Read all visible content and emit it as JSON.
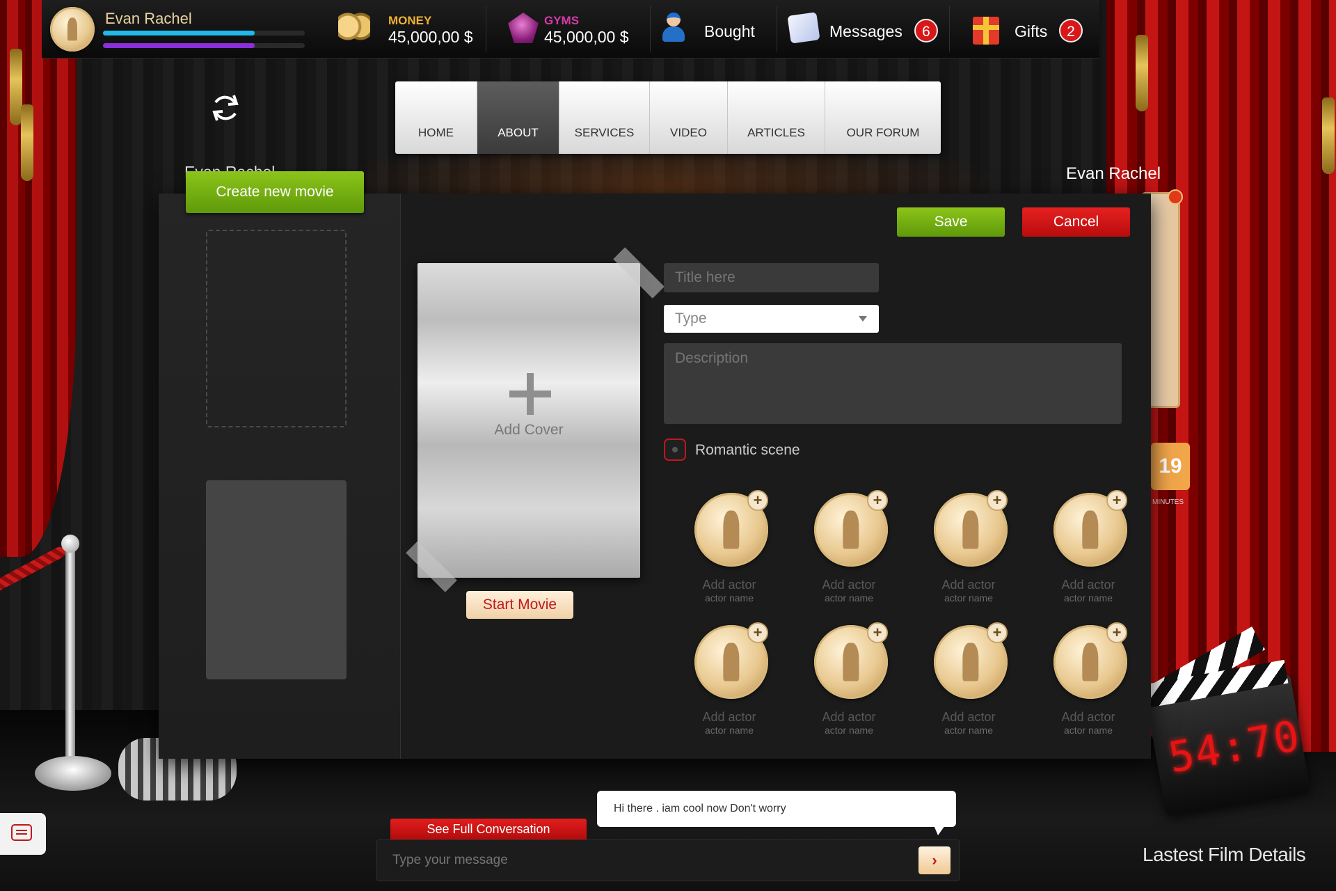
{
  "topbar": {
    "user_name": "Evan Rachel",
    "money_label": "MONEY",
    "money_value": "45,000,00 $",
    "gyms_label": "GYMS",
    "gyms_value": "45,000,00 $",
    "bought_label": "Bought",
    "messages_label": "Messages",
    "messages_count": "6",
    "gifts_label": "Gifts",
    "gifts_count": "2",
    "xp_fill": 0.75,
    "xp_fill_2": 0.75
  },
  "nav": {
    "items": [
      "HOME",
      "ABOUT",
      "SERVICES",
      "VIDEO",
      "ARTICLES",
      "OUR FORUM"
    ],
    "active": "ABOUT"
  },
  "background": {
    "name_left": "Evan Rachel",
    "name_right": "Evan Rachel",
    "timer_value": "19",
    "timer_unit": "MINUTES",
    "clapper_time": "54:70",
    "film_details": "Lastest Film Details"
  },
  "modal": {
    "create_button": "Create new movie",
    "save_button": "Save",
    "cancel_button": "Cancel",
    "add_cover_label": "Add Cover",
    "start_button": "Start Movie",
    "title_placeholder": "Title here",
    "type_placeholder": "Type",
    "description_placeholder": "Description",
    "romantic_label": "Romantic scene",
    "actors": [
      {
        "label": "Add actor",
        "sub": "actor name"
      },
      {
        "label": "Add actor",
        "sub": "actor name"
      },
      {
        "label": "Add actor",
        "sub": "actor name"
      },
      {
        "label": "Add actor",
        "sub": "actor name"
      },
      {
        "label": "Add actor",
        "sub": "actor name"
      },
      {
        "label": "Add actor",
        "sub": "actor name"
      },
      {
        "label": "Add actor",
        "sub": "actor name"
      },
      {
        "label": "Add actor",
        "sub": "actor name"
      }
    ],
    "actor_plus": "+"
  },
  "chat": {
    "see_full": "See Full Conversation",
    "message_placeholder": "Type your message",
    "bubble_text": "Hi there . iam cool now Don't worry",
    "send_glyph": "›"
  },
  "colors": {
    "accent_green": "#7ab317",
    "accent_red": "#d41818",
    "money_label": "#f2b233",
    "gyms_label": "#d43aa8",
    "xp_cyan": "#22b8e8",
    "xp_purple": "#8b2fd8"
  }
}
